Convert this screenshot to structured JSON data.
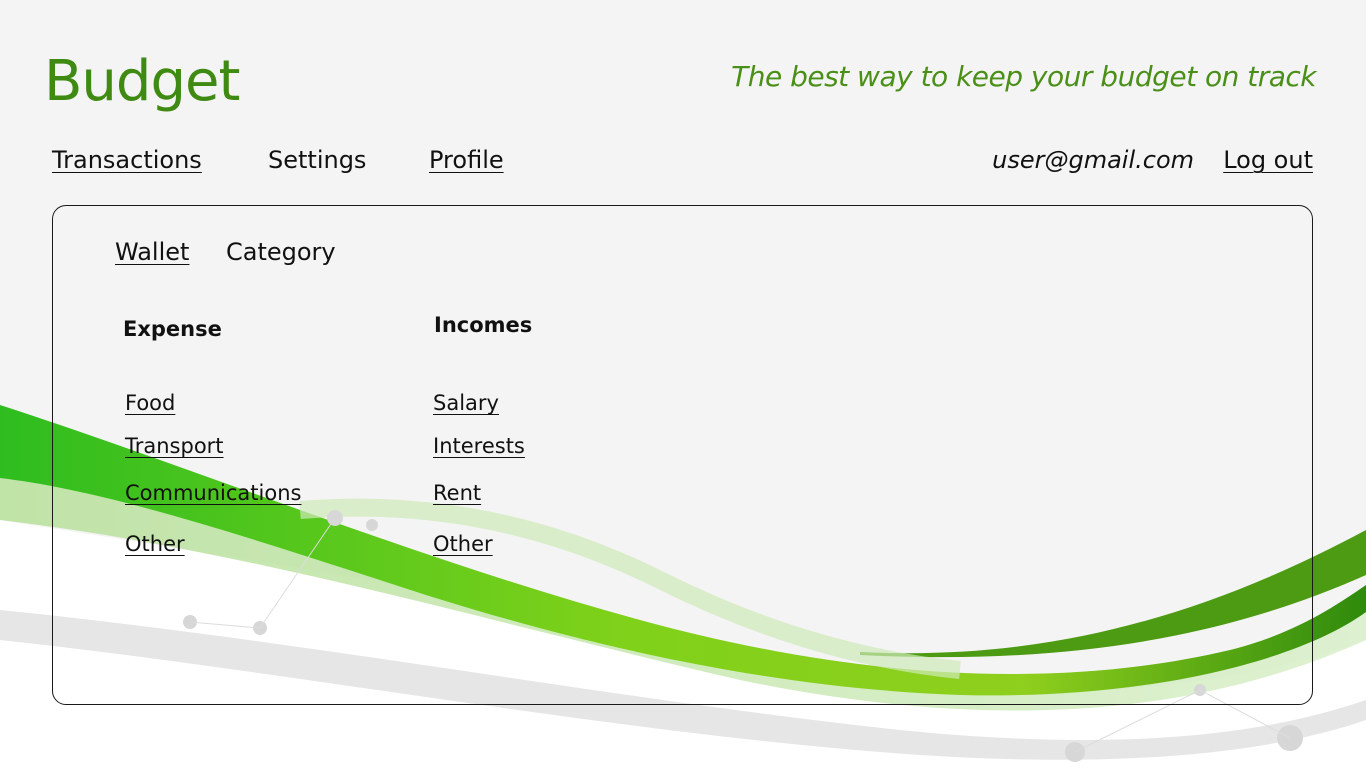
{
  "header": {
    "title": "Budget",
    "tagline": "The best way to keep your budget on track"
  },
  "nav": {
    "transactions": "Transactions",
    "settings": "Settings",
    "profile": "Profile",
    "user_email": "user@gmail.com",
    "logout": "Log out"
  },
  "tabs": {
    "wallet": "Wallet",
    "category": "Category"
  },
  "expense": {
    "heading": "Expense",
    "items": [
      "Food",
      "Transport",
      "Communications",
      "Other"
    ]
  },
  "incomes": {
    "heading": "Incomes",
    "items": [
      "Salary",
      "Interests",
      "Rent",
      "Other"
    ]
  },
  "colors": {
    "brand": "#3f8a12",
    "accent_green": "#4a8f17",
    "background": "#f4f4f4"
  }
}
